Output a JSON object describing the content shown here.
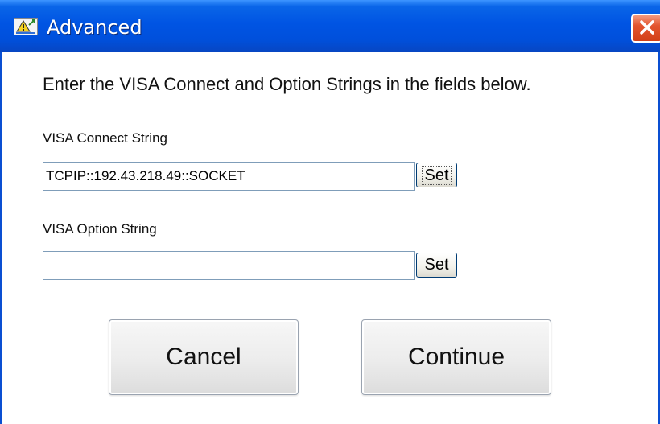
{
  "window": {
    "title": "Advanced",
    "icon": "app-icon",
    "close_icon": "close-icon",
    "colors": {
      "titlebar": "#0054e3",
      "close_button": "#e3552f",
      "background": "#ffffff"
    }
  },
  "instruction": "Enter the VISA Connect and Option Strings in the fields below.",
  "connect": {
    "label": "VISA Connect String",
    "value": "TCPIP::192.43.218.49::SOCKET",
    "set_label": "Set"
  },
  "option": {
    "label": "VISA Option String",
    "value": "",
    "set_label": "Set"
  },
  "buttons": {
    "cancel": "Cancel",
    "continue": "Continue"
  }
}
